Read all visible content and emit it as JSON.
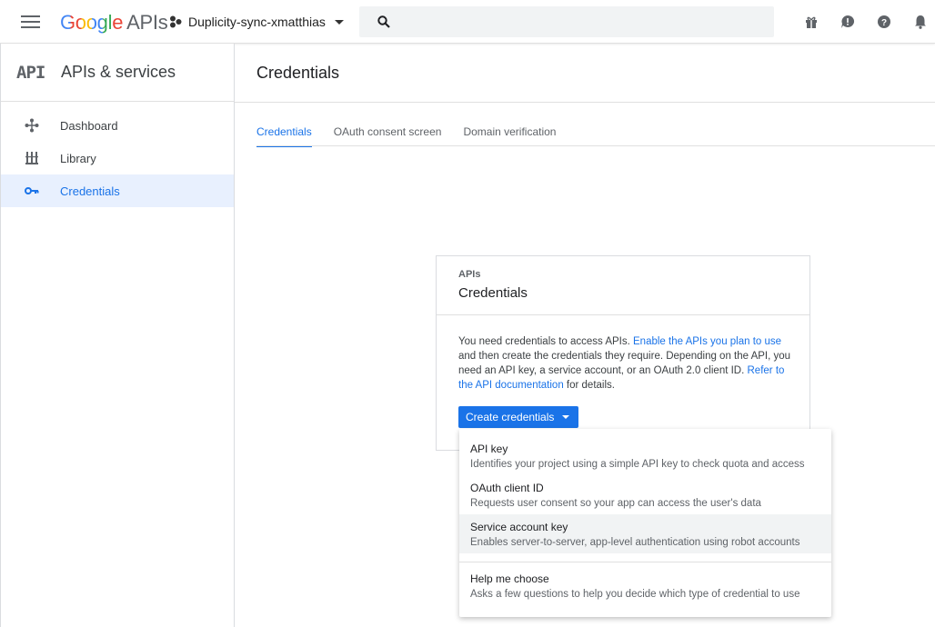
{
  "header": {
    "logo_google": "Google",
    "logo_apis": "APIs",
    "project_name": "Duplicity-sync-xmatthias",
    "search_placeholder": "",
    "icons": [
      "gift-icon",
      "feedback-icon",
      "help-icon",
      "notifications-icon"
    ]
  },
  "sidebar": {
    "logo_text": "API",
    "title": "APIs & services",
    "items": [
      {
        "label": "Dashboard",
        "icon": "dashboard-icon"
      },
      {
        "label": "Library",
        "icon": "library-icon"
      },
      {
        "label": "Credentials",
        "icon": "key-icon",
        "active": true
      }
    ]
  },
  "main": {
    "title": "Credentials",
    "tabs": [
      {
        "label": "Credentials",
        "active": true
      },
      {
        "label": "OAuth consent screen"
      },
      {
        "label": "Domain verification"
      }
    ]
  },
  "card": {
    "eyebrow": "APIs",
    "title": "Credentials",
    "text_1": "You need credentials to access APIs. ",
    "link_1": "Enable the APIs you plan to use",
    "text_2": " and then create the credentials they require. Depending on the API, you need an API key, a service account, or an OAuth 2.0 client ID. ",
    "link_2": "Refer to the API documentation",
    "text_3": " for details.",
    "button_label": "Create credentials"
  },
  "dropdown": {
    "items": [
      {
        "title": "API key",
        "desc": "Identifies your project using a simple API key to check quota and access"
      },
      {
        "title": "OAuth client ID",
        "desc": "Requests user consent so your app can access the user's data"
      },
      {
        "title": "Service account key",
        "desc": "Enables server-to-server, app-level authentication using robot accounts"
      },
      {
        "title": "Help me choose",
        "desc": "Asks a few questions to help you decide which type of credential to use"
      }
    ]
  },
  "colors": {
    "accent": "#1a73e8",
    "active_nav_bg": "#e8f0fe",
    "hover_bg": "#f1f3f4"
  }
}
